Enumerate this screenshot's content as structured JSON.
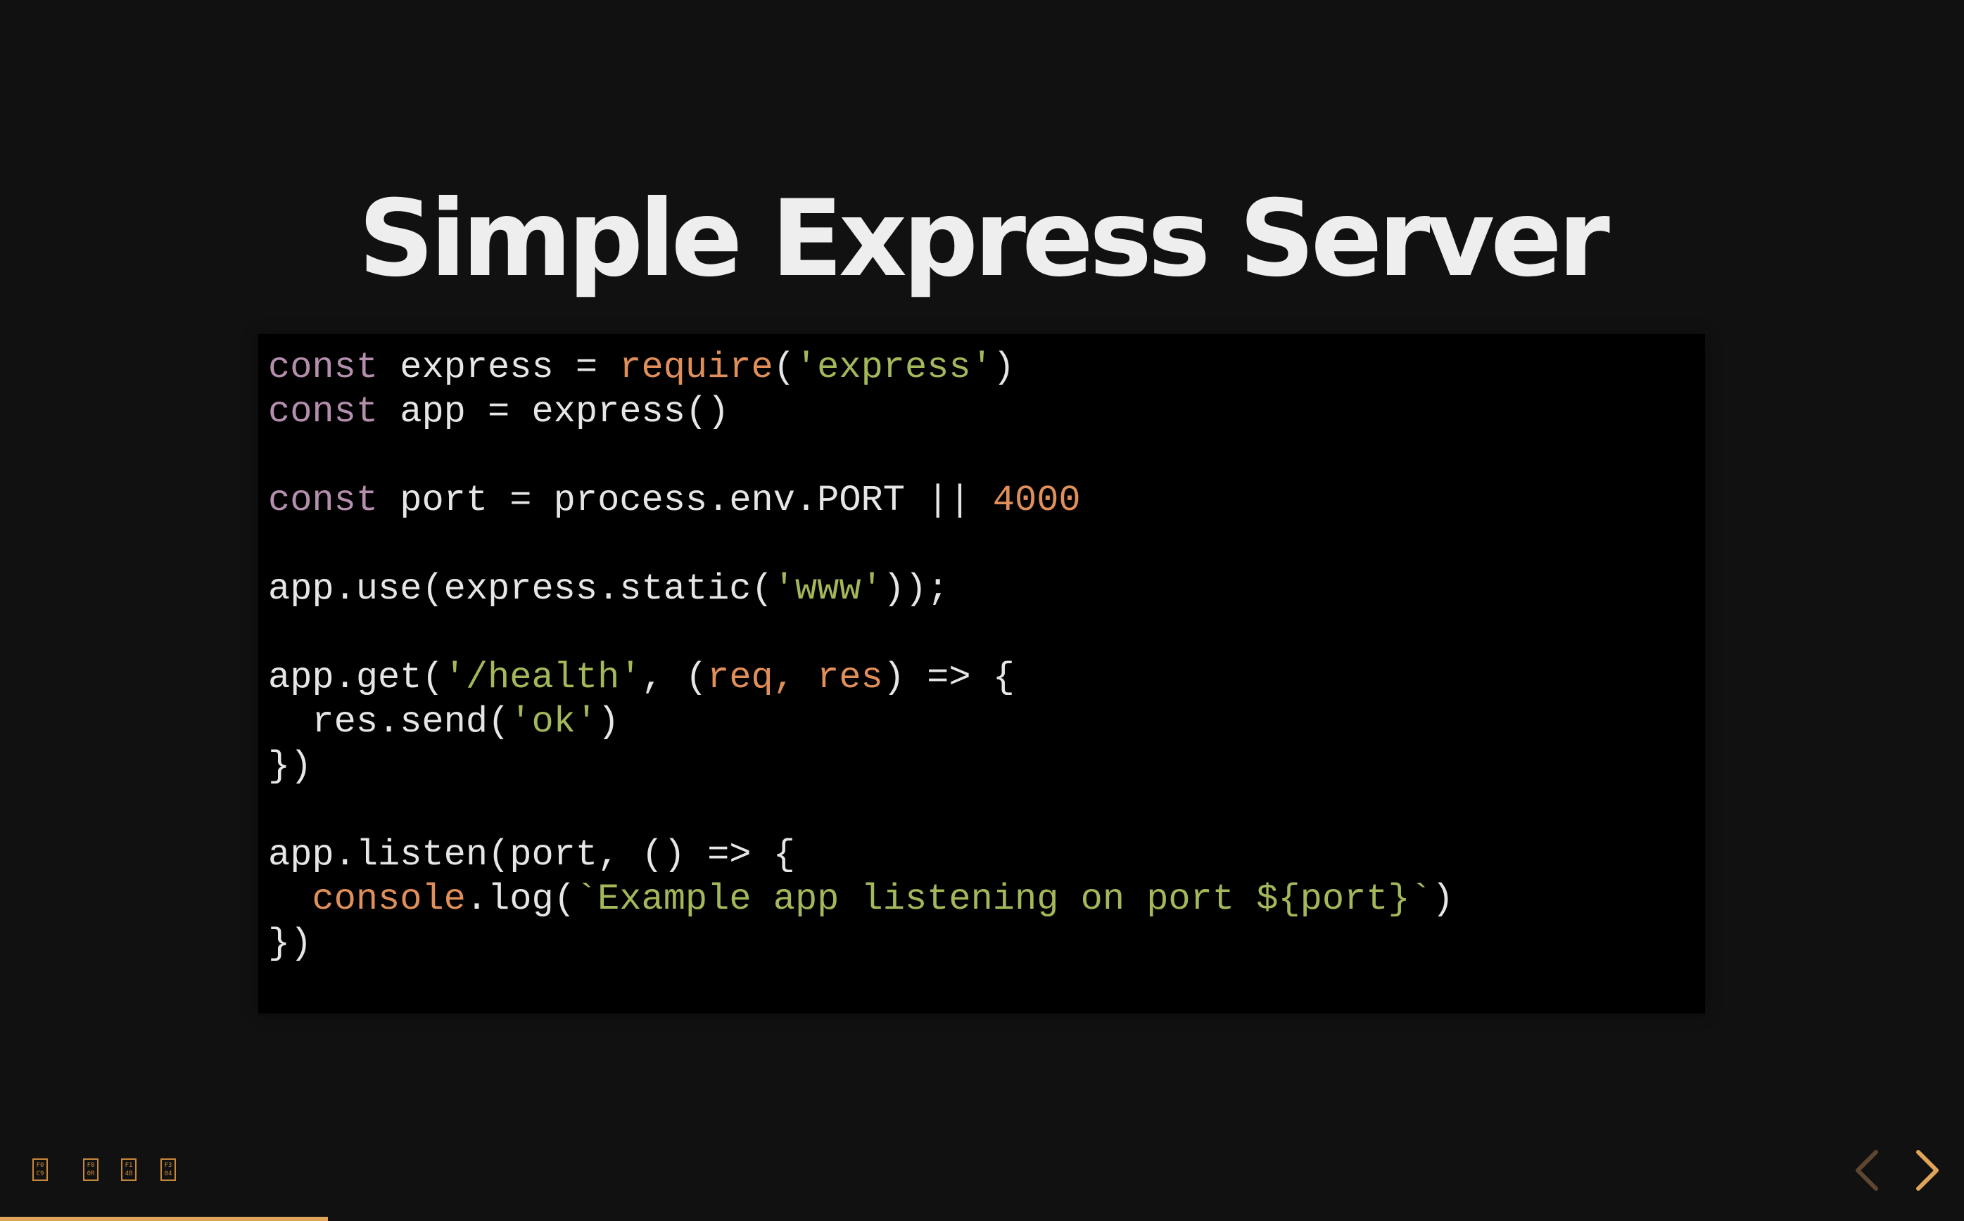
{
  "slide": {
    "title": "Simple Express Server"
  },
  "code": {
    "lines": [
      [
        {
          "t": "const",
          "c": "kw"
        },
        {
          "t": " express = ",
          "c": "plain"
        },
        {
          "t": "require",
          "c": "fn"
        },
        {
          "t": "(",
          "c": "plain"
        },
        {
          "t": "'express'",
          "c": "str"
        },
        {
          "t": ")",
          "c": "plain"
        }
      ],
      [
        {
          "t": "const",
          "c": "kw"
        },
        {
          "t": " app = express()",
          "c": "plain"
        }
      ],
      [],
      [
        {
          "t": "const",
          "c": "kw"
        },
        {
          "t": " port = process.env.PORT || ",
          "c": "plain"
        },
        {
          "t": "4000",
          "c": "num"
        }
      ],
      [],
      [
        {
          "t": "app.use(express.static(",
          "c": "plain"
        },
        {
          "t": "'www'",
          "c": "str"
        },
        {
          "t": "));",
          "c": "plain"
        }
      ],
      [],
      [
        {
          "t": "app.get(",
          "c": "plain"
        },
        {
          "t": "'/health'",
          "c": "str"
        },
        {
          "t": ", (",
          "c": "plain"
        },
        {
          "t": "req, res",
          "c": "param"
        },
        {
          "t": ") => {",
          "c": "plain"
        }
      ],
      [
        {
          "t": "  res.send(",
          "c": "plain"
        },
        {
          "t": "'ok'",
          "c": "str"
        },
        {
          "t": ")",
          "c": "plain"
        }
      ],
      [
        {
          "t": "})",
          "c": "plain"
        }
      ],
      [],
      [
        {
          "t": "app.listen(port, () => {",
          "c": "plain"
        }
      ],
      [
        {
          "t": "  ",
          "c": "plain"
        },
        {
          "t": "console",
          "c": "fn"
        },
        {
          "t": ".log(",
          "c": "plain"
        },
        {
          "t": "`Example app listening on port ${port}`",
          "c": "str"
        },
        {
          "t": ")",
          "c": "plain"
        }
      ],
      [
        {
          "t": "})",
          "c": "plain"
        }
      ]
    ]
  },
  "menu": {
    "icons": [
      {
        "name": "menu-icon-1",
        "glyph": "F0\nC9"
      },
      {
        "name": "menu-icon-2",
        "glyph": "F0\n0R"
      },
      {
        "name": "menu-icon-3",
        "glyph": "F1\n4B"
      },
      {
        "name": "menu-icon-4",
        "glyph": "F3\n04"
      }
    ]
  },
  "navigation": {
    "prev_icon": "chevron-left-icon",
    "next_icon": "chevron-right-icon"
  },
  "progress": {
    "fraction": 0.167
  },
  "colors": {
    "background": "#111111",
    "code_background": "#000000",
    "title": "#eeeeee",
    "accent": "#e0a458",
    "keyword": "#b48ead",
    "function": "#e08f5a",
    "string": "#a3b85a",
    "number": "#e08f5a"
  }
}
